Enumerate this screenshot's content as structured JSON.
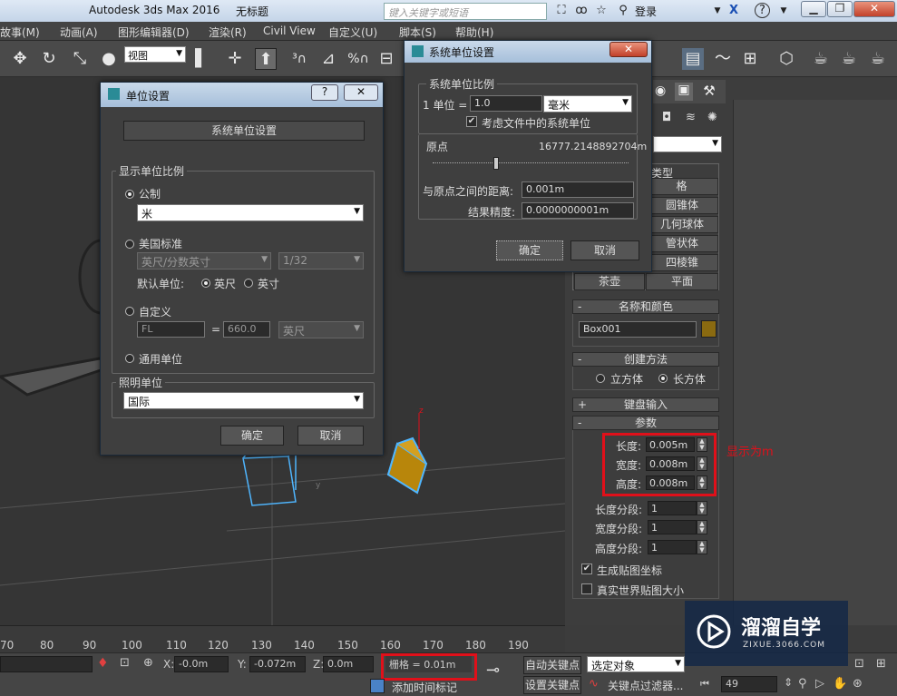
{
  "app": {
    "title": "Autodesk 3ds Max 2016",
    "doc_title": "无标题",
    "search_placeholder": "键入关键字或短语",
    "login": "登录",
    "help": "?"
  },
  "menubar": [
    "故事(M)",
    "动画(A)",
    "图形编辑器(D)",
    "渲染(R)",
    "Civil View",
    "自定义(U)",
    "脚本(S)",
    "帮助(H)"
  ],
  "toolbar": {
    "view_select": "视图"
  },
  "units_dialog": {
    "title": "单位设置",
    "help": "?",
    "close": "✕",
    "system_unit_button": "系统单位设置",
    "display_group": "显示单位比例",
    "metric_label": "公制",
    "metric_value": "米",
    "us_label": "美国标准",
    "us_value": "英尺/分数英寸",
    "us_fraction": "1/32",
    "default_unit_label": "默认单位:",
    "feet_label": "英尺",
    "inch_label": "英寸",
    "custom_label": "自定义",
    "custom_name": "FL",
    "custom_eq": "=",
    "custom_value": "660.0",
    "custom_unit": "英尺",
    "generic_label": "通用单位",
    "lighting_group": "照明单位",
    "lighting_value": "国际",
    "ok": "确定",
    "cancel": "取消"
  },
  "system_dialog": {
    "title": "系统单位设置",
    "close": "✕",
    "scale_group": "系统单位比例",
    "one_unit_label": "1 单位 =",
    "one_unit_value": "1.0",
    "unit_value": "毫米",
    "respect_label": "考虑文件中的系统单位",
    "origin_label": "原点",
    "origin_value": "16777.2148892704m",
    "distance_label": "与原点之间的距离:",
    "distance_value": "0.001m",
    "precision_label": "结果精度:",
    "precision_value": "0.0000000001m",
    "ok": "确定",
    "cancel": "取消"
  },
  "command_panel": {
    "dropdown_value": "",
    "group_title": "类型",
    "buttons": [
      {
        "left": "",
        "right": "格"
      },
      {
        "left": "",
        "right": "圆锥体"
      },
      {
        "left": "",
        "right": "几何球体"
      },
      {
        "left": "",
        "right": "管状体"
      },
      {
        "left": "",
        "right": "四棱锥"
      },
      {
        "left": "茶壶",
        "right": "平面"
      }
    ],
    "name_color_header": "名称和颜色",
    "object_name": "Box001",
    "object_color": "#8a6a10",
    "creation_header": "创建方法",
    "cube_label": "立方体",
    "box_label": "长方体",
    "keyboard_header": "键盘输入",
    "params_header": "参数",
    "length_label": "长度:",
    "length_value": "0.005m",
    "width_label": "宽度:",
    "width_value": "0.008m",
    "height_label": "高度:",
    "height_value": "0.008m",
    "length_segs_label": "长度分段:",
    "length_segs": "1",
    "width_segs_label": "宽度分段:",
    "width_segs": "1",
    "height_segs_label": "高度分段:",
    "height_segs": "1",
    "gen_mapping_label": "生成贴图坐标",
    "real_world_label": "真实世界贴图大小",
    "annotation": "显示为m"
  },
  "timeline": {
    "ticks": [
      "70",
      "80",
      "90",
      "100",
      "110",
      "120",
      "130",
      "140",
      "150",
      "160",
      "170",
      "180",
      "190"
    ]
  },
  "statusbar": {
    "x_label": "X:",
    "x_value": "-0.0m",
    "y_label": "Y:",
    "y_value": "-0.072m",
    "z_label": "Z:",
    "z_value": "0.0m",
    "grid_value": "栅格 = 0.01m",
    "auto_key": "自动关键点",
    "selection_value": "选定对象",
    "set_key": "设置关键点",
    "key_filter": "关键点过滤器...",
    "frame_value": "49",
    "add_time_tag": "添加时间标记"
  },
  "watermark": {
    "brand": "溜溜自学",
    "url": "ZIXUE.3066.COM"
  },
  "colors": {
    "highlight_red": "#e0101a",
    "box_gold": "#b8860b",
    "dialog_title": "#b8cde3"
  }
}
